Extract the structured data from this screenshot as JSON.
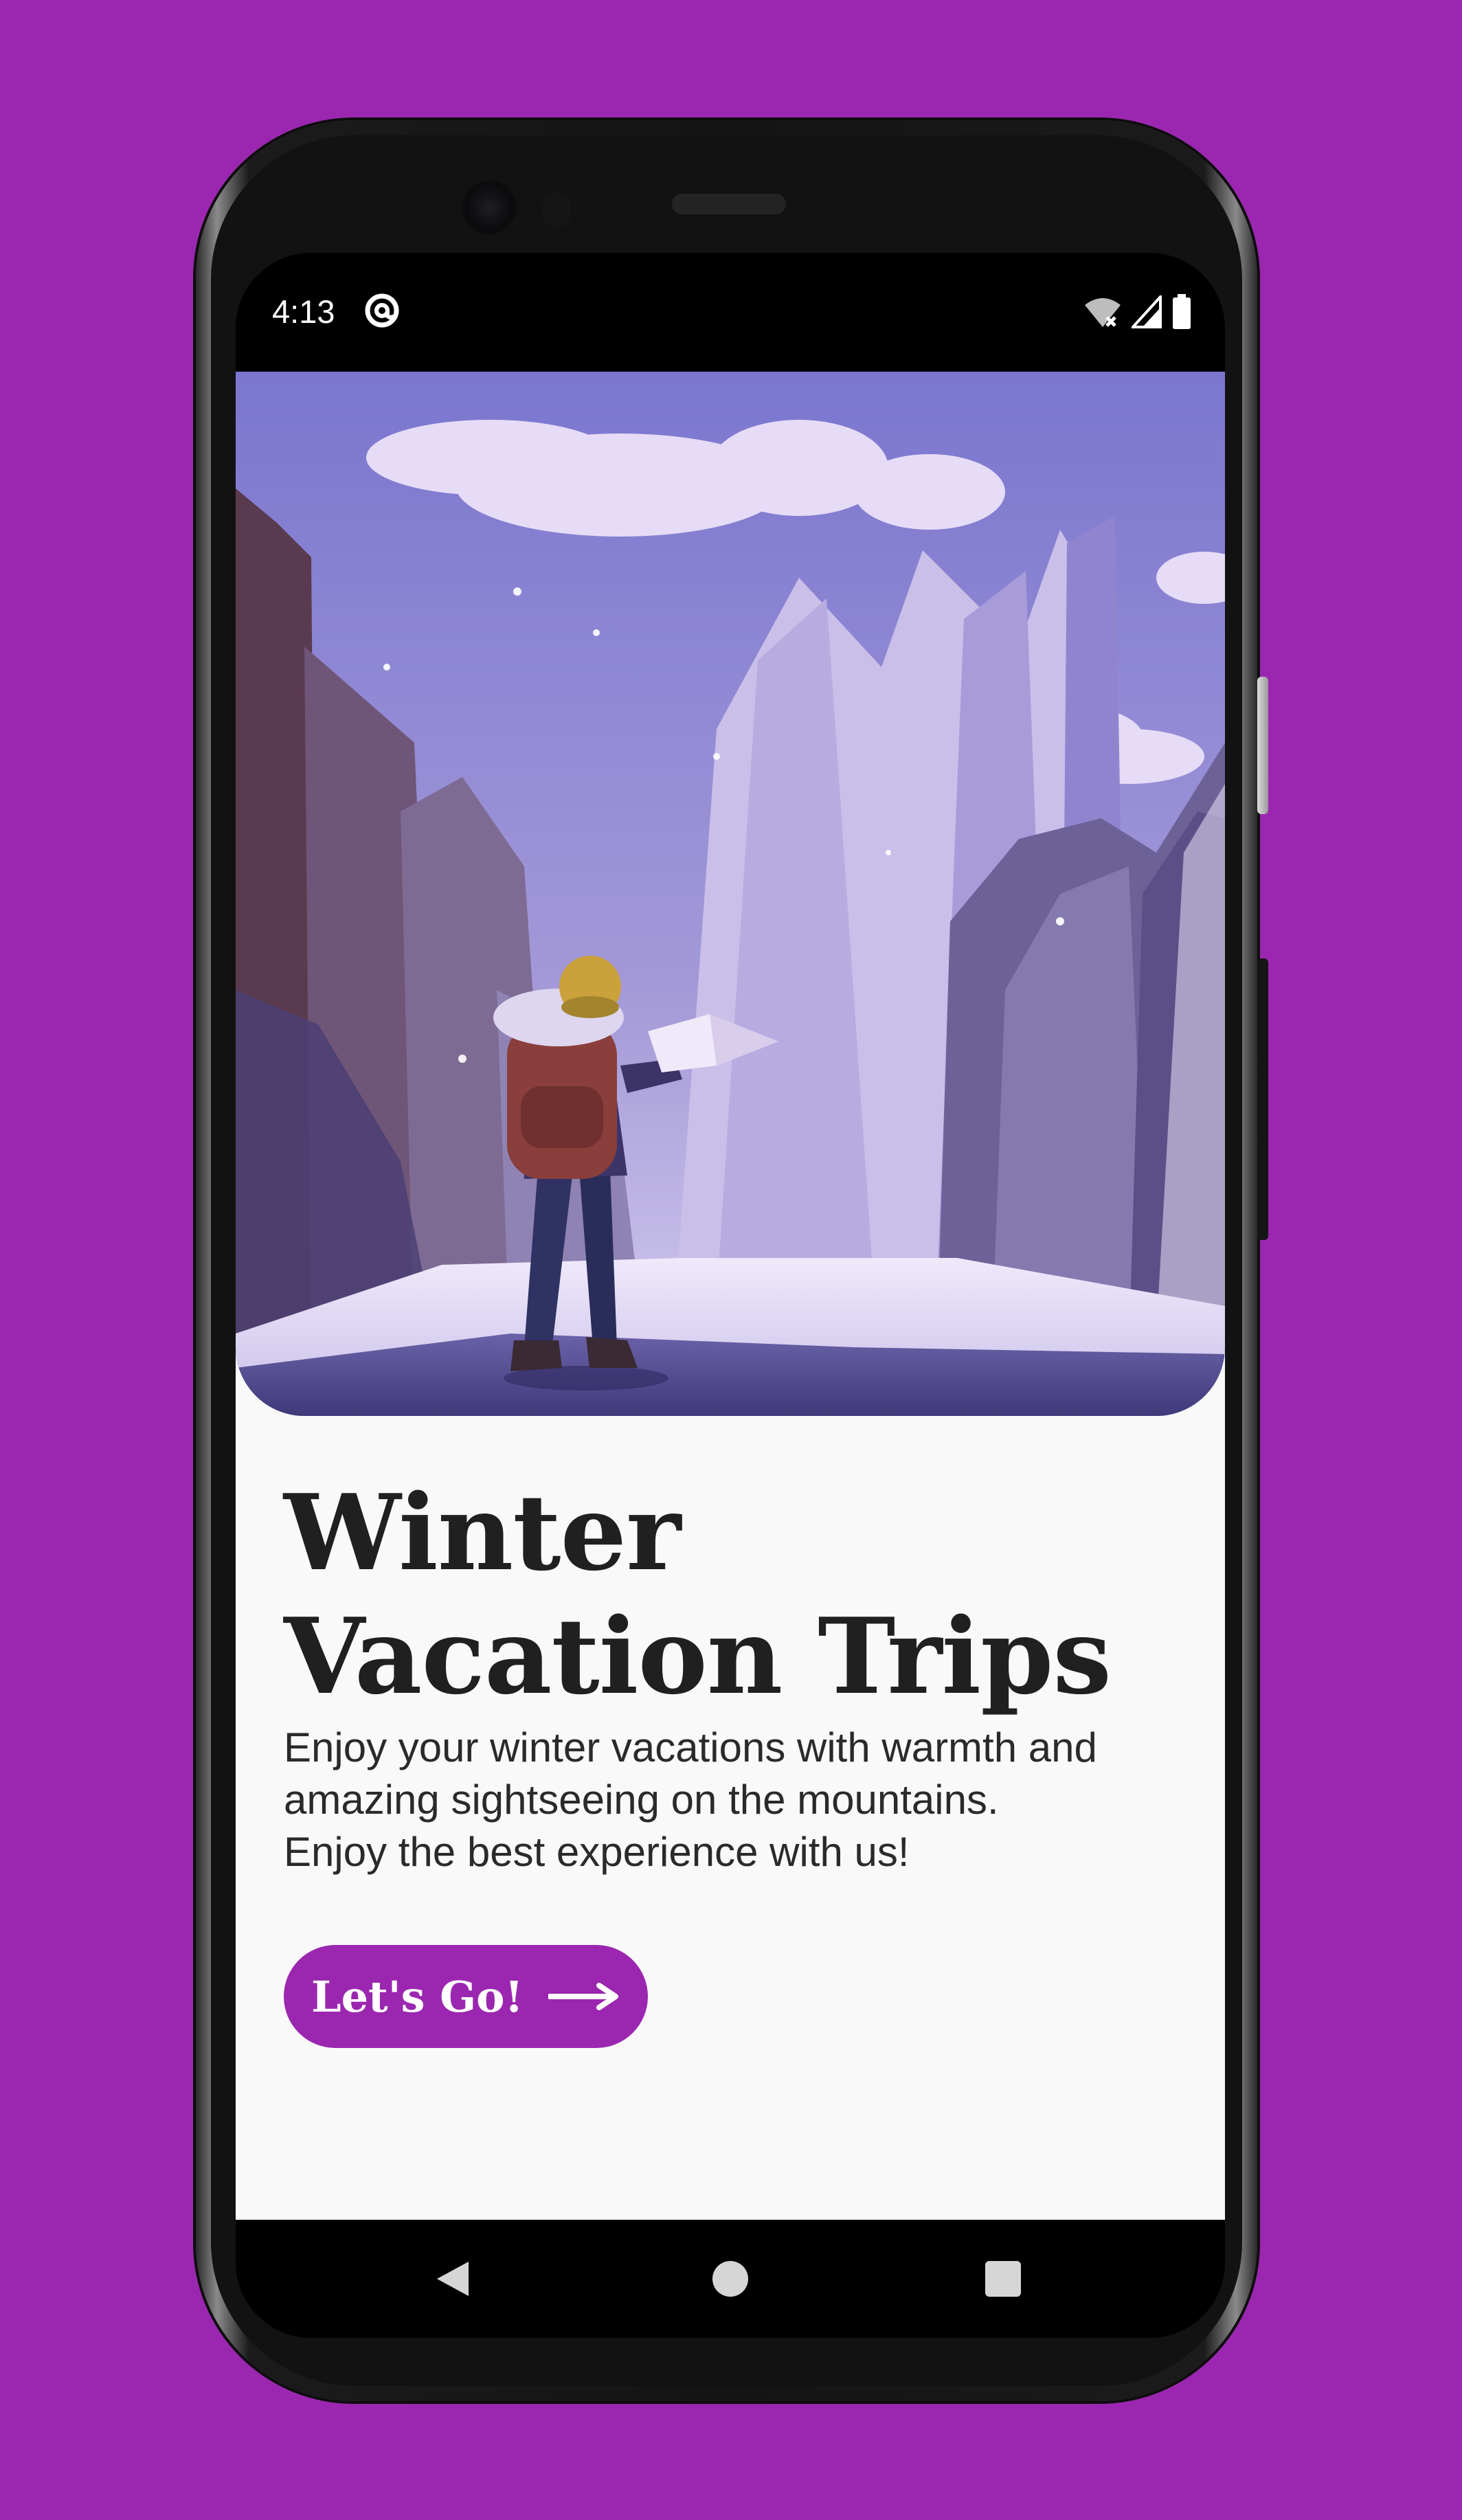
{
  "colors": {
    "background": "#9b27b0",
    "accent": "#9b27b0",
    "screen_bg": "#f9f9f9",
    "text": "#202020"
  },
  "status_bar": {
    "time": "4:13",
    "app_icon": "at-sign-notification-icon",
    "icons": [
      "wifi-off-icon",
      "cellular-signal-icon",
      "battery-icon"
    ]
  },
  "hero": {
    "image": "winter-hiker-illustration"
  },
  "content": {
    "title_line1": "Winter",
    "title_line2": "Vacation Trips",
    "description_line1": "Enjoy your winter vacations with warmth and",
    "description_line2": "amazing sightseeing on the mountains.",
    "description_line3": "Enjoy the best experience with us!",
    "button_label": "Let's Go!",
    "button_icon": "arrow-right-icon"
  },
  "nav_bar": {
    "buttons": [
      "back-icon",
      "home-icon",
      "recents-icon"
    ]
  }
}
